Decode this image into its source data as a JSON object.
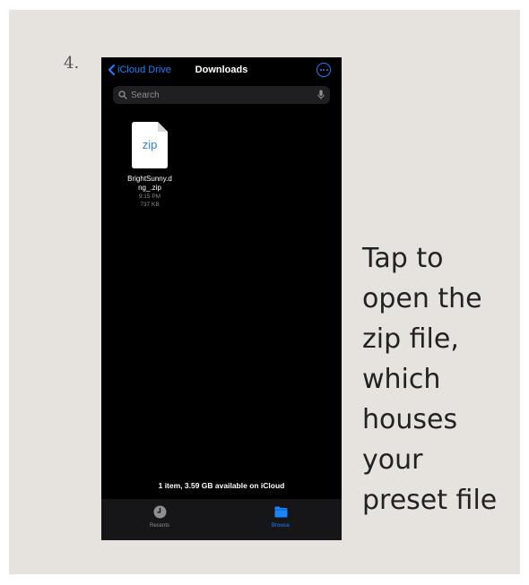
{
  "step": {
    "number": "4."
  },
  "nav": {
    "back_label": "iCloud Drive",
    "title": "Downloads"
  },
  "search": {
    "placeholder": "Search"
  },
  "file": {
    "extension": "zip",
    "name_line1": "BrightSunny.d",
    "name_line2": "ng_.zip",
    "time": "9:15 PM",
    "size": "737 KB"
  },
  "summary": "1 item, 3.59 GB available on iCloud",
  "tabs": [
    {
      "label": "Recents",
      "icon": "clock-icon",
      "active": false
    },
    {
      "label": "Browse",
      "icon": "folder-icon",
      "active": true
    }
  ],
  "caption": [
    "Tap to",
    "open the",
    "zip file,",
    "which",
    "houses",
    "your",
    "preset file"
  ],
  "colors": {
    "accent": "#1a84ff",
    "background": "#e6e2de",
    "screen": "#000000",
    "file_icon_text": "#2f7de1"
  }
}
